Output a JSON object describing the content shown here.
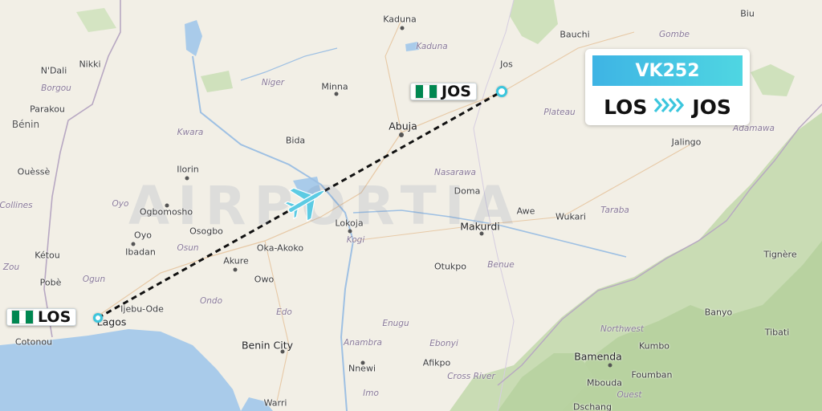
{
  "flight": {
    "number": "VK252",
    "origin": "LOS",
    "destination": "JOS",
    "origin_country_flag": "nigeria-flag",
    "destination_country_flag": "nigeria-flag"
  },
  "watermark": "AIRPORTIA",
  "icons": {
    "plane": "airplane-icon",
    "route_arrow": "chevrons-right-icon"
  },
  "colors": {
    "route_accent": "#3cc6dd",
    "flight_banner_start": "#3eb4e4",
    "flight_banner_end": "#4fd6e2",
    "flag_green": "#008751"
  },
  "cities": {
    "kaduna": "Kaduna",
    "bauchi": "Bauchi",
    "biu": "Biu",
    "jos": "Jos",
    "minna": "Minna",
    "abuja": "Abuja",
    "bida": "Bida",
    "ilorin": "Ilorin",
    "ogbomosho": "Ogbomosho",
    "oyo": "Oyo",
    "osogbo": "Osogbo",
    "ibadan": "Ibadan",
    "akure": "Akure",
    "oka_akoko": "Oka-Akoko",
    "owo": "Owo",
    "lokoja": "Lokoja",
    "makurdi": "Makurdi",
    "domа": "Doma",
    "awe": "Awe",
    "wukari": "Wukari",
    "jalingo": "Jalingo",
    "otukpo": "Otukpo",
    "ijebu_ode": "Ijebu-Ode",
    "lagos": "Lagos",
    "cotonou": "Cotonou",
    "benin_city": "Benin City",
    "nnewi": "Nnewi",
    "afikpo": "Afikpo",
    "warri": "Warri",
    "nikki": "Nikki",
    "ndali": "N'Dali",
    "parakou": "Parakou",
    "ouesse": "Ouèssè",
    "ketou": "Kétou",
    "pobe": "Pobè",
    "bamenda": "Bamenda",
    "kumbo": "Kumbo",
    "foumban": "Foumban",
    "mbouda": "Mbouda",
    "dschang": "Dschang",
    "banyo": "Banyo",
    "tignere": "Tignère",
    "tibati": "Tibati"
  },
  "regions": {
    "gombe": "Gombe",
    "kaduna": "Kaduna",
    "niger": "Niger",
    "plateau": "Plateau",
    "adamawa": "Adamawa",
    "borgou": "Borgou",
    "kwara": "Kwara",
    "nasarawa": "Nasarawa",
    "taraba": "Taraba",
    "oyo": "Oyo",
    "osun": "Osun",
    "kogi": "Kogi",
    "ogun": "Ogun",
    "ondo": "Ondo",
    "benue": "Benue",
    "edo": "Edo",
    "enugu": "Enugu",
    "ebonyi": "Ebonyi",
    "anambra": "Anambra",
    "cross_river": "Cross River",
    "imo": "Imo",
    "northwest": "Northwest",
    "ouest": "Ouest",
    "collines": "Collines",
    "zou": "Zou"
  },
  "countries": {
    "benin": "Bénin"
  }
}
